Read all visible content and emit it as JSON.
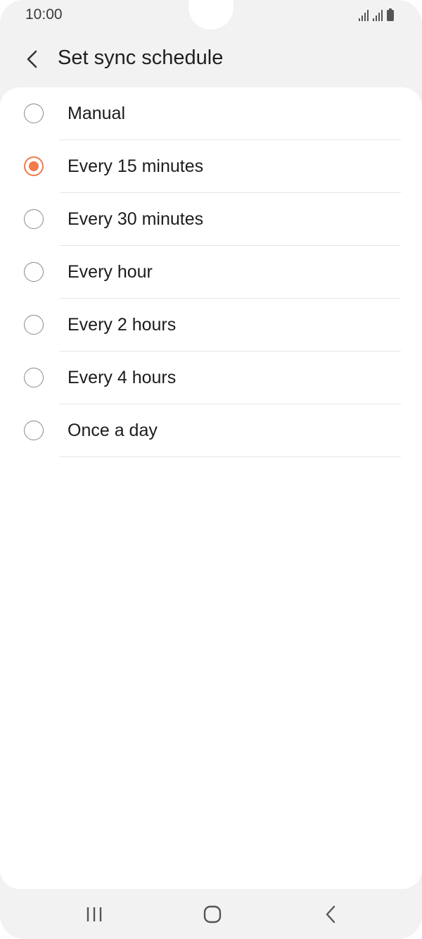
{
  "status_bar": {
    "time": "10:00",
    "icons": [
      "signal-icon",
      "signal-icon",
      "battery-icon"
    ]
  },
  "header": {
    "back_icon": "chevron-left-icon",
    "title": "Set sync schedule"
  },
  "options": [
    {
      "label": "Manual",
      "selected": false
    },
    {
      "label": "Every 15 minutes",
      "selected": true
    },
    {
      "label": "Every 30 minutes",
      "selected": false
    },
    {
      "label": "Every hour",
      "selected": false
    },
    {
      "label": "Every 2 hours",
      "selected": false
    },
    {
      "label": "Every 4 hours",
      "selected": false
    },
    {
      "label": "Once a day",
      "selected": false
    }
  ],
  "nav_bar": {
    "recent_icon": "recent-apps-icon",
    "home_icon": "home-icon",
    "back_icon": "back-icon"
  },
  "colors": {
    "accent": "#f27b4c",
    "background": "#f2f2f2",
    "card": "#ffffff"
  }
}
